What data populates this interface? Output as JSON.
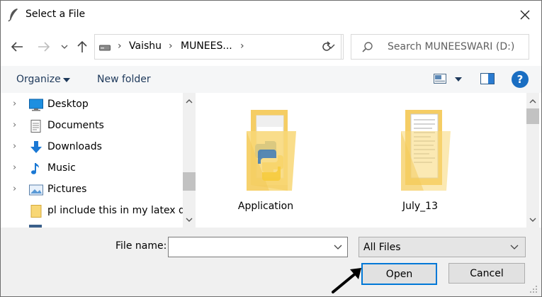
{
  "window": {
    "title": "Select a File"
  },
  "address": {
    "segments": [
      "Vaishu",
      "MUNEES..."
    ],
    "search_placeholder": "Search MUNEESWARI (D:)"
  },
  "toolbar": {
    "organize_label": "Organize",
    "new_folder_label": "New folder",
    "help_label": "?"
  },
  "nav_items": [
    {
      "label": "Desktop",
      "icon": "desktop-icon",
      "expandable": true
    },
    {
      "label": "Documents",
      "icon": "documents-icon",
      "expandable": true
    },
    {
      "label": "Downloads",
      "icon": "downloads-icon",
      "expandable": true
    },
    {
      "label": "Music",
      "icon": "music-icon",
      "expandable": true
    },
    {
      "label": "Pictures",
      "icon": "pictures-icon",
      "expandable": true
    },
    {
      "label": "pl include this in my latex da",
      "icon": "folder-icon",
      "expandable": false
    }
  ],
  "files": [
    {
      "name": "Application",
      "icon": "python-folder-icon"
    },
    {
      "name": "July_13",
      "icon": "document-folder-icon"
    }
  ],
  "bottom": {
    "file_name_label": "File name:",
    "file_name_value": "",
    "filter_value": "All Files",
    "open_label": "Open",
    "cancel_label": "Cancel"
  },
  "colors": {
    "accent": "#0078d7",
    "folder": "#f8d775",
    "toolbar_text": "#1e395b"
  }
}
